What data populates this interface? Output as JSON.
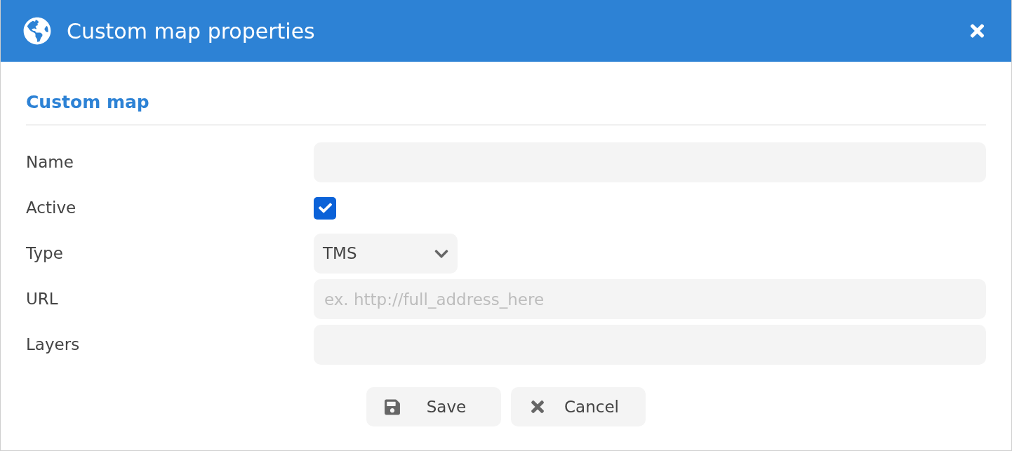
{
  "window": {
    "title": "Custom map properties"
  },
  "section": {
    "title": "Custom map"
  },
  "fields": [
    {
      "kind": "text",
      "label": "Name"
    },
    {
      "kind": "checkbox",
      "label": "Active",
      "checked": true
    },
    {
      "kind": "select",
      "label": "Type",
      "value": "TMS"
    },
    {
      "kind": "text",
      "label": "URL",
      "placeholder": "ex. http://full_address_here"
    },
    {
      "kind": "text",
      "label": "Layers"
    }
  ],
  "buttons": [
    {
      "kind": "save",
      "label": "Save"
    },
    {
      "kind": "cancel",
      "label": "Cancel"
    }
  ]
}
